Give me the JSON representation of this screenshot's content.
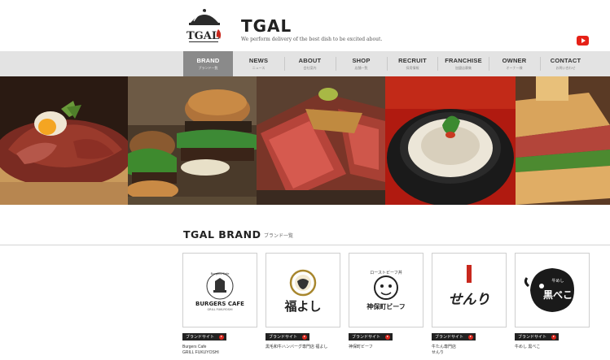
{
  "header": {
    "logo_text": "TGAL",
    "site_title": "TGAL",
    "tagline": "We perform delivery of the best dish to be excited about.",
    "youtube_icon": "youtube-icon"
  },
  "nav": {
    "items": [
      {
        "label": "BRAND",
        "sub": "ブランド一覧",
        "active": true
      },
      {
        "label": "NEWS",
        "sub": "ニュース",
        "active": false
      },
      {
        "label": "ABOUT",
        "sub": "会社案内",
        "active": false
      },
      {
        "label": "SHOP",
        "sub": "店舗一覧",
        "active": false
      },
      {
        "label": "RECRUIT",
        "sub": "採用情報",
        "active": false
      },
      {
        "label": "FRANCHISE",
        "sub": "加盟店募集",
        "active": false
      },
      {
        "label": "OWNER",
        "sub": "オーナー様",
        "active": false
      },
      {
        "label": "CONTACT",
        "sub": "お問い合わせ",
        "active": false
      }
    ]
  },
  "section": {
    "title": "TGAL BRAND",
    "subtitle": "ブランド一覧"
  },
  "brands": [
    {
      "logo_main": "BURGERS CAFE",
      "logo_sub": "GRILL FUKUYOSHI",
      "logo_top": "Burgers Cafe",
      "badge": "ブランドサイト",
      "name": "Burgers Cafe\nGRILL FUKUYOSHI"
    },
    {
      "logo_main": "福よし",
      "badge": "ブランドサイト",
      "name": "黒毛和牛ハンバーグ専門店 福よし"
    },
    {
      "logo_main": "神保町ビーフ",
      "logo_top": "ローストビーフ丼",
      "badge": "ブランドサイト",
      "name": "神保町ビーフ"
    },
    {
      "logo_main": "せんり",
      "badge": "ブランドサイト",
      "name": "牛たん専門店\nせんり"
    },
    {
      "logo_main": "黒べこ",
      "logo_top": "牛めし",
      "badge": "ブランドサイト",
      "name": "牛めし 黒べこ"
    }
  ],
  "colors": {
    "nav_bg": "#e3e3e3",
    "nav_active": "#8a8a8a",
    "badge_bg": "#222222",
    "badge_dot": "#d9261c",
    "youtube": "#e62117"
  }
}
